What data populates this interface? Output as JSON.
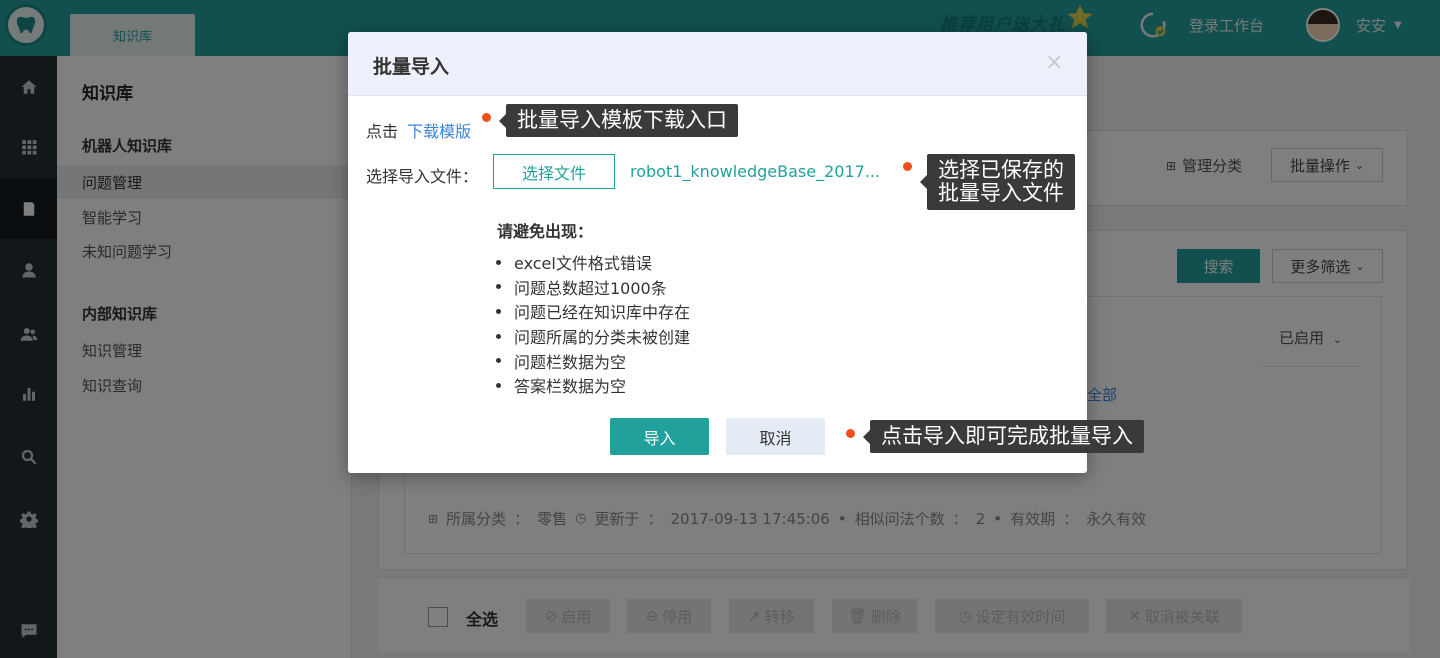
{
  "header": {
    "tab_label": "知识库",
    "promo_text": "推荐用户送大礼",
    "workbench_label": "登录工作台",
    "user_name": "安安"
  },
  "rail": {
    "icons": [
      "home-icon",
      "apps-grid-icon",
      "book-icon",
      "user-icon",
      "users-icon",
      "bar-chart-icon",
      "search-icon",
      "settings-icon",
      "chat-icon"
    ],
    "active_index": 2
  },
  "sidebar": {
    "title": "知识库",
    "robot_group": "机器人知识库",
    "robot_items": [
      "问题管理",
      "智能学习",
      "未知问题学习"
    ],
    "internal_group": "内部知识库",
    "internal_items": [
      "知识管理",
      "知识查询"
    ]
  },
  "main": {
    "manage_category": "管理分类",
    "batch_ops": "批量操作",
    "search_btn": "搜索",
    "more_filter": "更多筛选",
    "enabled_select": "已启用",
    "all_link": "全部",
    "meta": {
      "category_label": "所属分类",
      "category_value": "零售",
      "updated_label": "更新于",
      "updated_value": "2017-09-13 17:45:06",
      "similar_label": "相似问法个数",
      "similar_value": "2",
      "validity_label": "有效期",
      "validity_value": "永久有效",
      "colon": "：",
      "sep": "•"
    },
    "bottom": {
      "select_all": "全选",
      "enable": "启用",
      "disable": "停用",
      "move": "转移",
      "delete": "删除",
      "set_validity": "设定有效时间",
      "unlink": "取消被关联"
    }
  },
  "modal": {
    "title": "批量导入",
    "close": "×",
    "click_prefix": "点击",
    "download_link": "下载模版",
    "file_label": "选择导入文件：",
    "file_button": "选择文件",
    "file_name": "robot1_knowledgeBase_2017...",
    "avoid_title": "请避免出现：",
    "rules": [
      "excel文件格式错误",
      "问题总数超过1000条",
      "问题已经在知识库中存在",
      "问题所属的分类未被创建",
      "问题栏数据为空",
      "答案栏数据为空"
    ],
    "import_button": "导入",
    "cancel_button": "取消"
  },
  "annotations": {
    "tip_download": "批量导入模板下载入口",
    "tip_file_line1": "选择已保存的",
    "tip_file_line2": "批量导入文件",
    "tip_import": "点击导入即可完成批量导入"
  },
  "colors": {
    "brand": "#22a19c",
    "link": "#3e86d9",
    "annotation_dot": "#f04f1a",
    "tooltip_bg": "#3a3a3a"
  }
}
